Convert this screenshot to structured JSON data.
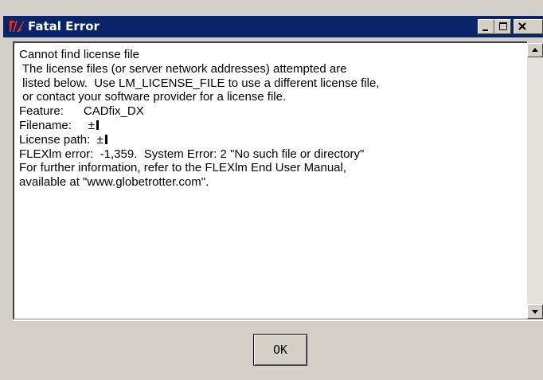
{
  "window": {
    "title": "Fatal Error",
    "icon": "tk-feather-icon",
    "controls": {
      "minimize": "minimize-icon",
      "maximize": "maximize-icon",
      "close": "close-icon"
    }
  },
  "message": {
    "lines": [
      "Cannot find license file",
      " The license files (or server network addresses) attempted are",
      " listed below.  Use LM_LICENSE_FILE to use a different license file,",
      " or contact your software provider for a license file.",
      "Feature:      CADfix_DX",
      "Filename:     ±",
      "License path:  ±",
      "FLEXlm error:  -1,359.  System Error: 2 \"No such file or directory\"",
      "For further information, refer to the FLEXlm End User Manual,",
      "available at \"www.globetrotter.com\"."
    ]
  },
  "buttons": {
    "ok_label": "OK"
  },
  "colors": {
    "title_bar": "#0a246a",
    "face": "#d4d0c8"
  }
}
